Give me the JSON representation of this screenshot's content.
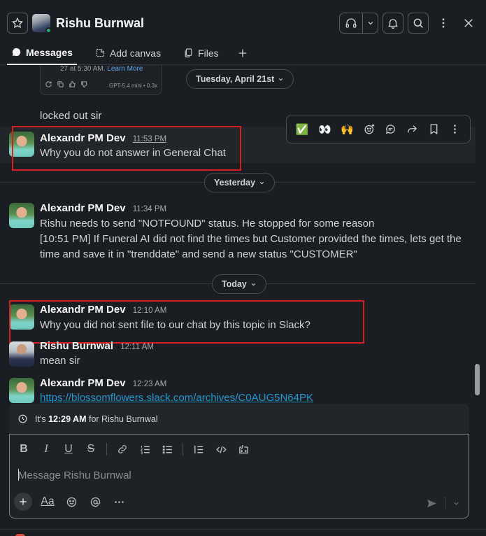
{
  "header": {
    "title": "Rishu Burnwal",
    "presence": "online"
  },
  "tabs": [
    {
      "label": "Messages"
    },
    {
      "label": "Add canvas"
    },
    {
      "label": "Files"
    }
  ],
  "card_fragment": {
    "text_prefix": "27 at 5:30 AM.",
    "link_text": "Learn More",
    "model_text": "GPT-5.4 mini • 0.3x"
  },
  "date_dividers": {
    "first": "Tuesday, April 21st",
    "second": "Yesterday",
    "third": "Today"
  },
  "messages": {
    "locked_out": "locked out sir",
    "m1": {
      "author": "Alexandr PM Dev",
      "time": "11:53 PM",
      "text": "Why you do not answer in General Chat"
    },
    "m2": {
      "author": "Alexandr PM Dev",
      "time": "11:34 PM",
      "line1": "Rishu needs to send \"NOTFOUND\" status. He stopped for some reason",
      "line2": "[10:51 PM] If Funeral AI did not find the times but Customer provided the times, lets get the",
      "line3": "time and save it in  \"trenddate\"  and send a new status \"CUSTOMER\""
    },
    "m3": {
      "author": "Alexandr PM Dev",
      "time": "12:10 AM",
      "text": "Why you did not sent file to our chat by this topic in Slack?"
    },
    "m4": {
      "author": "Rishu Burnwal",
      "time": "12:11 AM",
      "text": "mean sir"
    },
    "m5": {
      "author": "Alexandr PM Dev",
      "time": "12:23 AM",
      "link": "https://blossomflowers.slack.com/archives/C0AUG5N64PK"
    }
  },
  "quick_reactions": [
    "✅",
    "👀",
    "🙌"
  ],
  "local_time": {
    "prefix": "It's",
    "time": "12:29 AM",
    "suffix": "for Rishu Burnwal"
  },
  "composer": {
    "placeholder": "Message Rishu Burnwal",
    "format_label": "Aa"
  },
  "colors": {
    "background": "#1a1d21",
    "link": "#1d9bd1",
    "annotation_box": "#d42020",
    "presence": "#2bac76"
  }
}
